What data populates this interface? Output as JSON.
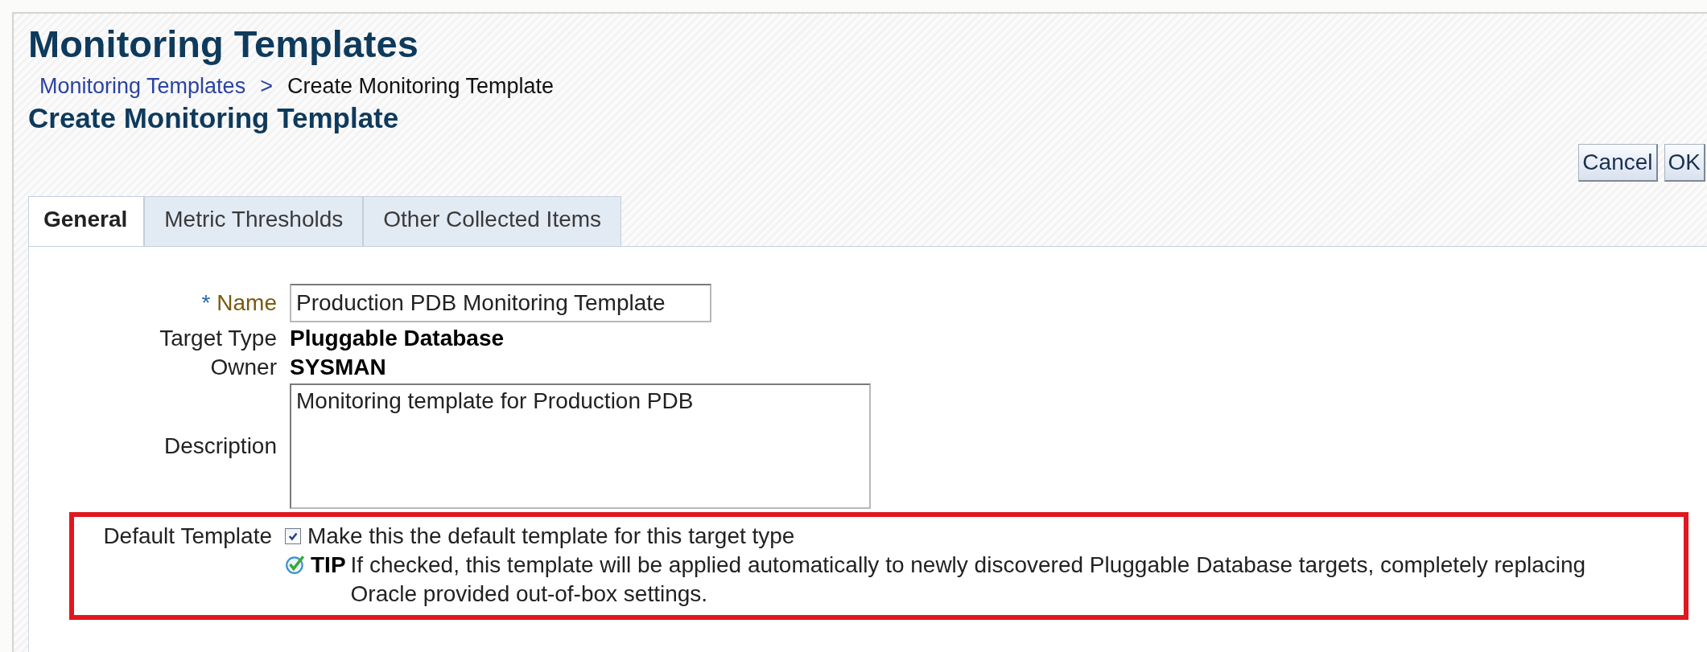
{
  "page": {
    "title": "Monitoring Templates",
    "breadcrumb": [
      {
        "label": "Monitoring Templates",
        "link": true
      },
      {
        "label": "Create Monitoring Template",
        "link": false
      }
    ],
    "breadcrumb_separator": ">",
    "subtitle": "Create Monitoring Template"
  },
  "buttons": [
    "Cancel",
    "OK"
  ],
  "tabs": [
    {
      "label": "General",
      "selected": true
    },
    {
      "label": "Metric Thresholds",
      "selected": false
    },
    {
      "label": "Other Collected Items",
      "selected": false
    }
  ],
  "form": {
    "name": {
      "label": "Name",
      "required_mark": "*",
      "value": "Production PDB Monitoring Template"
    },
    "target_type": {
      "label": "Target Type",
      "value": "Pluggable Database"
    },
    "owner": {
      "label": "Owner",
      "value": "SYSMAN"
    },
    "description": {
      "label": "Description",
      "value": "Monitoring template for Production PDB"
    },
    "default_template": {
      "label": "Default Template",
      "checked": true,
      "checkbox_label": "Make this the default template for this target type",
      "tip_label": "TIP",
      "tip_lines": [
        "If checked, this template will be applied automatically to newly discovered Pluggable Database targets, completely replacing",
        "Oracle provided out-of-box settings."
      ],
      "highlighted": true
    }
  }
}
